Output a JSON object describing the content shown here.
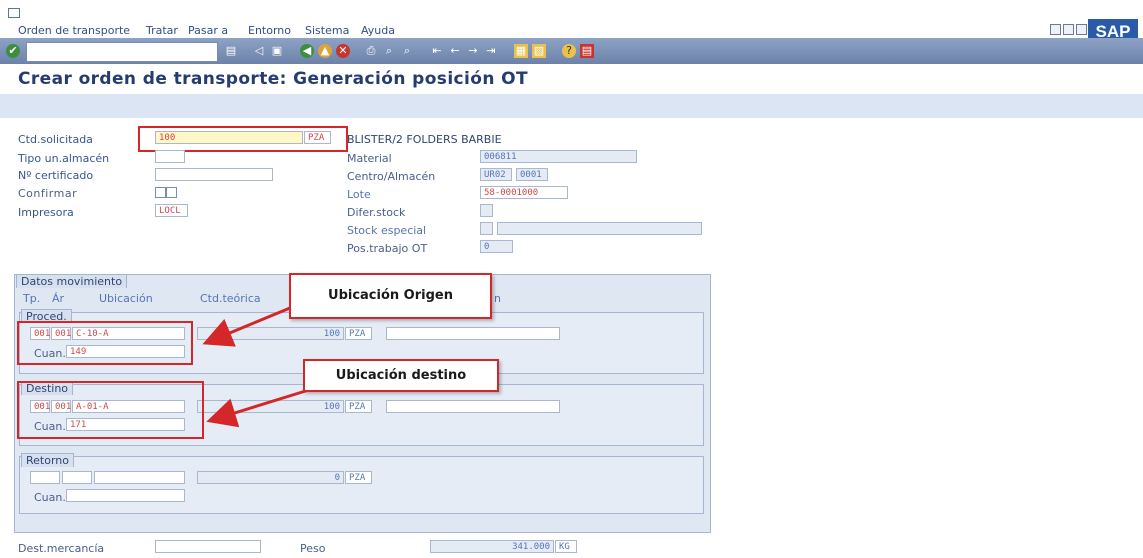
{
  "menubar": {
    "items": [
      "Orden de transporte",
      "Tratar",
      "Pasar a",
      "Entorno",
      "Sistema",
      "Ayuda"
    ],
    "logo": "SAP"
  },
  "toolbar": {
    "command_field_value": "",
    "icons": [
      "enter-icon",
      "back-icon",
      "save-icon",
      "back-green-icon",
      "exit-icon",
      "cancel-icon",
      "print-icon",
      "find-icon",
      "find-next-icon",
      "first-page-icon",
      "prev-page-icon",
      "next-page-icon",
      "last-page-icon",
      "new-session-icon",
      "shortcut-icon",
      "help-icon",
      "layout-icon"
    ]
  },
  "page": {
    "title": "Crear orden de transporte: Generación posición OT"
  },
  "header": {
    "ctd_solicitada_label": "Ctd.solicitada",
    "ctd_solicitada_value": "100",
    "ctd_unit": "PZA",
    "tipo_label": "Tipo un.almacén",
    "tipo_value": "",
    "cert_label": "Nº certificado",
    "cert_value": "",
    "confirmar_label": "Confirmar",
    "impresora_label": "Impresora",
    "impresora_value": "LOCL",
    "material_desc": "BLISTER/2 FOLDERS BARBIE",
    "material_label": "Material",
    "material_value": "006811",
    "centro_label": "Centro/Almacén",
    "centro_value": "UR02",
    "almacen_value": "0001",
    "lote_label": "Lote",
    "lote_value": "58-0001000",
    "difer_label": "Difer.stock",
    "difer_value": "",
    "stock_label": "Stock especial",
    "pos_label": "Pos.trabajo OT",
    "pos_value": "0"
  },
  "movement": {
    "section_title": "Datos movimiento",
    "col_tp": "Tp.",
    "col_ar": "Ár",
    "col_ubicacion": "Ubicación",
    "col_ctd": "Ctd.teórica",
    "col_n": "n",
    "proced": {
      "title": "Proced.",
      "tp": "001",
      "ar": "001",
      "ubicacion": "C-10-A",
      "ctd": "100",
      "unit": "PZA",
      "cuan_label": "Cuan.",
      "cuan_value": "149"
    },
    "destino": {
      "title": "Destino",
      "tp": "001",
      "ar": "001",
      "ubicacion": "A-01-A",
      "ctd": "100",
      "unit": "PZA",
      "cuan_label": "Cuan.",
      "cuan_value": "171"
    },
    "retorno": {
      "title": "Retorno",
      "ctd": "0",
      "unit": "PZA",
      "cuan_label": "Cuan."
    }
  },
  "footer": {
    "dest_label": "Dest.mercancía",
    "dest_value": "",
    "peso_label": "Peso",
    "peso_value": "341.000",
    "peso_unit": "KG"
  },
  "annotations": {
    "origen": "Ubicación Origen",
    "destino": "Ubicación destino"
  },
  "colors": {
    "highlight": "#d3272a",
    "accent": "#2a5ba8"
  }
}
